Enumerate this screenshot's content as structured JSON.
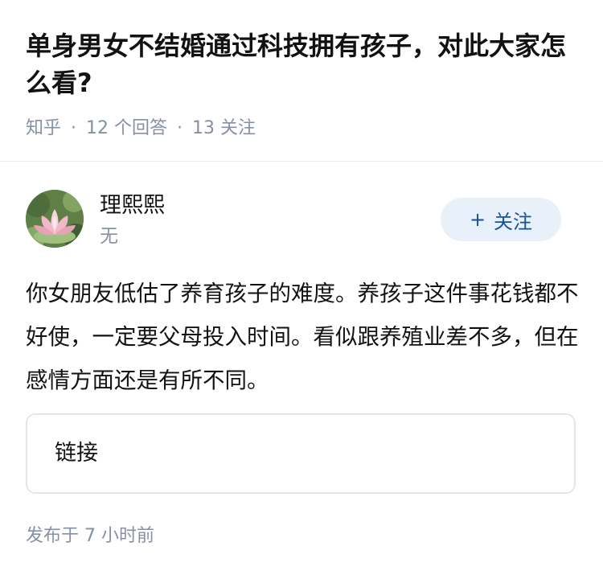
{
  "question": {
    "title": "单身男女不结婚通过科技拥有孩子，对此大家怎么看?",
    "source": "知乎",
    "separator": "·",
    "answers_count": "12 个回答",
    "follows_count": "13 关注"
  },
  "answer": {
    "author": {
      "name": "理熙熙",
      "bio": "无",
      "avatar_icon": "lotus-avatar-icon"
    },
    "follow_button": {
      "icon": "+",
      "label": "关注"
    },
    "content": "你女朋友低估了养育孩子的难度。养孩子这件事花钱都不好使，一定要父母投入时间。看似跟养殖业差不多，但在感情方面还是有所不同。",
    "link_card_label": "链接",
    "published": "发布于 7 小时前"
  },
  "colors": {
    "meta_gray": "#8590a6",
    "follow_bg": "#e8f0f9",
    "follow_text": "#175199"
  }
}
